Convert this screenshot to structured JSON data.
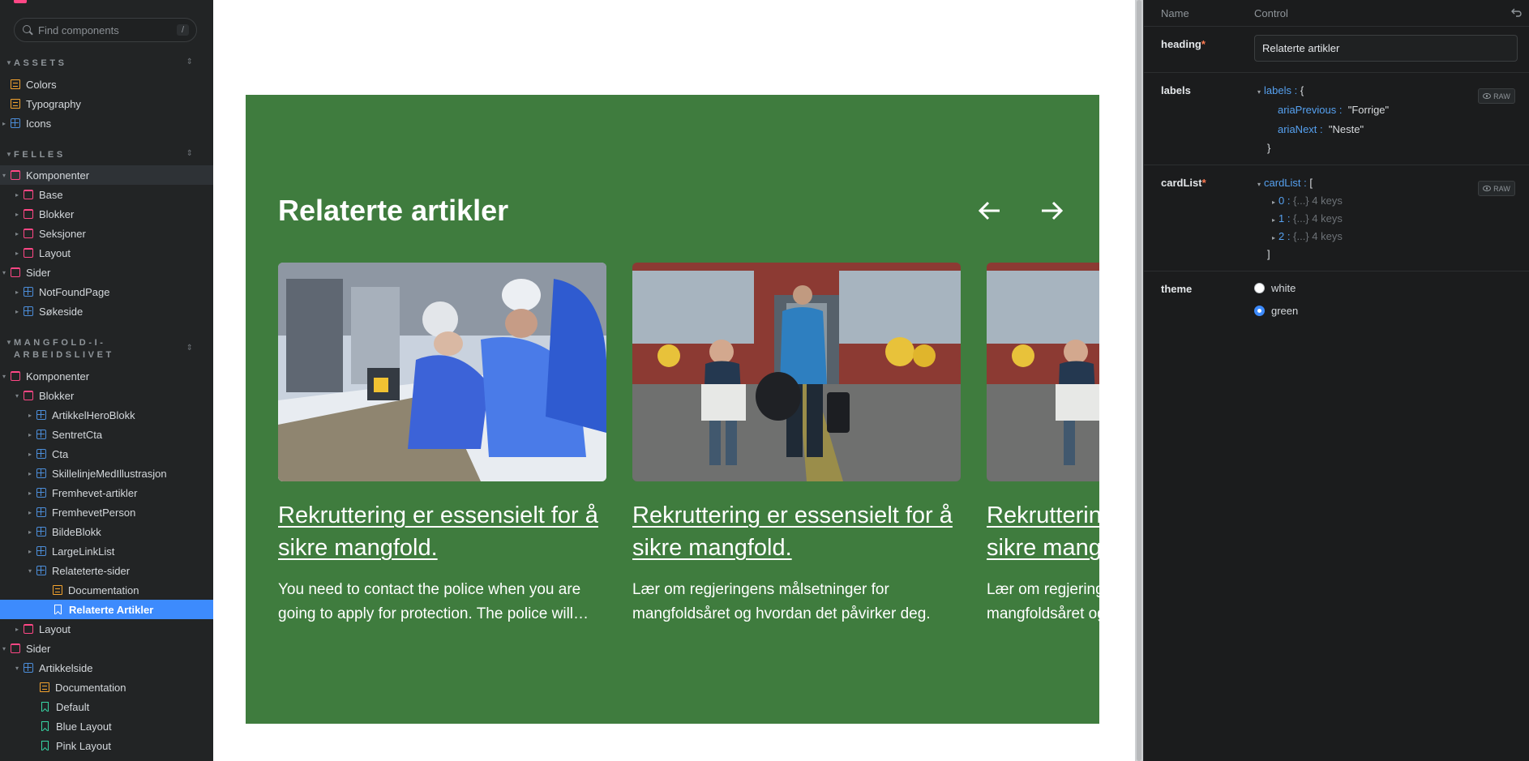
{
  "search": {
    "placeholder": "Find components",
    "shortcut": "/"
  },
  "sidebar": {
    "sections": [
      {
        "title": "ASSETS"
      },
      {
        "title": "FELLES"
      },
      {
        "title": "MANGFOLD-I-ARBEIDSLIVET"
      }
    ],
    "assets": [
      "Colors",
      "Typography",
      "Icons"
    ],
    "felles": [
      "Komponenter",
      "Base",
      "Blokker",
      "Seksjoner",
      "Layout",
      "Sider",
      "NotFoundPage",
      "Søkeside"
    ],
    "mangfold": [
      "Komponenter",
      "Blokker",
      "ArtikkelHeroBlokk",
      "SentretCta",
      "Cta",
      "SkillelinjeMedIllustrasjon",
      "Fremhevet-artikler",
      "FremhevetPerson",
      "BildeBlokk",
      "LargeLinkList",
      "Relateterte-sider",
      "Documentation",
      "Relaterte Artikler",
      "Layout",
      "Sider",
      "Artikkelside",
      "Documentation",
      "Default",
      "Blue Layout",
      "Pink Layout"
    ]
  },
  "preview": {
    "heading": "Relaterte artikler",
    "cards": [
      {
        "title": "Rekruttering er essensielt for å sikre mangfold.",
        "description": "You need to contact the police when you are going to apply for protection. The police will…"
      },
      {
        "title": "Rekruttering er essensielt for å sikre mangfold.",
        "description": "Lær om regjeringens målsetninger for mangfoldsåret og hvordan det påvirker deg."
      },
      {
        "title": "Rekruttering er essensielt for å sikre mangfold.",
        "description": "Lær om regjeringens målsetninger for mangfoldsåret og hvordan det påvirker deg."
      }
    ]
  },
  "controls": {
    "header": {
      "name": "Name",
      "control": "Control"
    },
    "heading": {
      "label": "heading",
      "required": "*",
      "value": "Relaterte artikler"
    },
    "labels": {
      "label": "labels",
      "key": "labels",
      "open": "{",
      "close": "}",
      "colon": ":",
      "entries": [
        {
          "key": "ariaPrevious",
          "value": "\"Forrige\""
        },
        {
          "key": "ariaNext",
          "value": "\"Neste\""
        }
      ],
      "raw": "RAW"
    },
    "cardList": {
      "label": "cardList",
      "required": "*",
      "key": "cardList",
      "open": "[",
      "close": "]",
      "colon": ":",
      "items": [
        {
          "index": "0",
          "summary": "{...} 4 keys"
        },
        {
          "index": "1",
          "summary": "{...} 4 keys"
        },
        {
          "index": "2",
          "summary": "{...} 4 keys"
        }
      ],
      "raw": "RAW"
    },
    "theme": {
      "label": "theme",
      "options": [
        "white",
        "green"
      ],
      "selected": "green"
    }
  },
  "colors": {
    "accent": "#3d8bfd",
    "preview_green": "#3f7c3e",
    "storybook_pink": "#ff4785"
  }
}
